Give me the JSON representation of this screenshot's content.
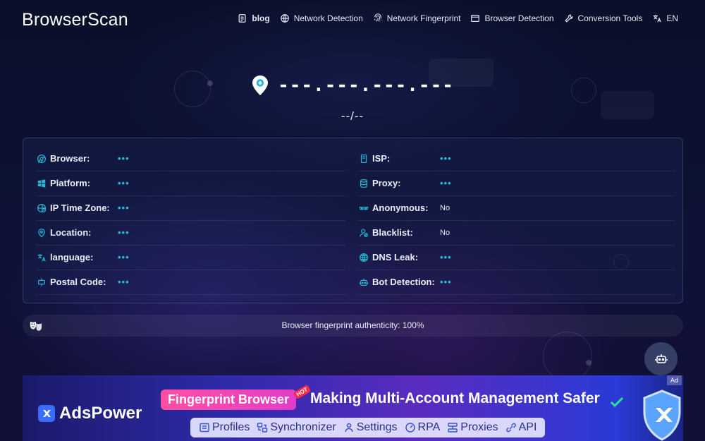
{
  "header": {
    "logo": "BrowserScan",
    "nav": [
      {
        "label": "blog",
        "icon": "blog-icon"
      },
      {
        "label": "Network Detection",
        "icon": "globe-icon"
      },
      {
        "label": "Network Fingerprint",
        "icon": "fingerprint-icon"
      },
      {
        "label": "Browser Detection",
        "icon": "browser-window-icon"
      },
      {
        "label": "Conversion Tools",
        "icon": "wrench-icon"
      },
      {
        "label": "EN",
        "icon": "translate-icon"
      }
    ]
  },
  "ip": {
    "address": "---.---.---.---",
    "timezone": "--/--"
  },
  "info": {
    "left": [
      {
        "label": "Browser:",
        "value": "•••"
      },
      {
        "label": "Platform:",
        "value": "•••"
      },
      {
        "label": "IP Time Zone:",
        "value": "•••"
      },
      {
        "label": "Location:",
        "value": "•••"
      },
      {
        "label": "language:",
        "value": "•••"
      },
      {
        "label": "Postal Code:",
        "value": "•••"
      }
    ],
    "right": [
      {
        "label": "ISP:",
        "value": "•••"
      },
      {
        "label": "Proxy:",
        "value": "•••"
      },
      {
        "label": "Anonymous:",
        "value": "No"
      },
      {
        "label": "Blacklist:",
        "value": "No"
      },
      {
        "label": "DNS Leak:",
        "value": "•••"
      },
      {
        "label": "Bot Detection:",
        "value": "•••"
      }
    ]
  },
  "authenticity": {
    "text": "Browser fingerprint authenticity: 100%"
  },
  "ad": {
    "tag": "Ad",
    "brand": "AdsPower",
    "pill": "Fingerprint Browser",
    "hot": "HOT",
    "headline": "Making Multi-Account Management Safer",
    "features": [
      "Profiles",
      "Synchronizer",
      "Settings",
      "RPA",
      "Proxies",
      "API"
    ]
  },
  "colors": {
    "accent": "#27b7d6",
    "background": "#0b1030"
  }
}
